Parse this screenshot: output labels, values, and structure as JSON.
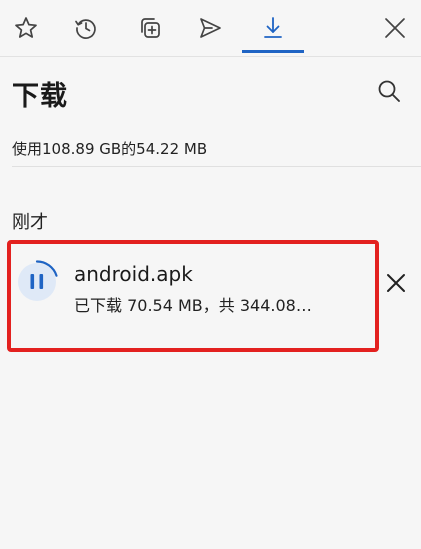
{
  "tabs": [
    {
      "name": "favorites",
      "icon": "star-icon"
    },
    {
      "name": "history",
      "icon": "history-icon"
    },
    {
      "name": "collections",
      "icon": "collections-icon"
    },
    {
      "name": "share",
      "icon": "send-icon"
    },
    {
      "name": "downloads",
      "icon": "download-icon",
      "active": true
    },
    {
      "name": "close",
      "icon": "close-icon"
    }
  ],
  "header": {
    "title": "下载"
  },
  "storage_text": "使用108.89 GB的54.22 MB",
  "section_label": "刚才",
  "download": {
    "filename": "android.apk",
    "status": "已下载 70.54 MB，共 344.08…",
    "state": "paused-icon",
    "progress": 0.2
  },
  "colors": {
    "accent": "#1f64c4",
    "highlight": "#e3211f",
    "background": "#f6f6f6"
  }
}
